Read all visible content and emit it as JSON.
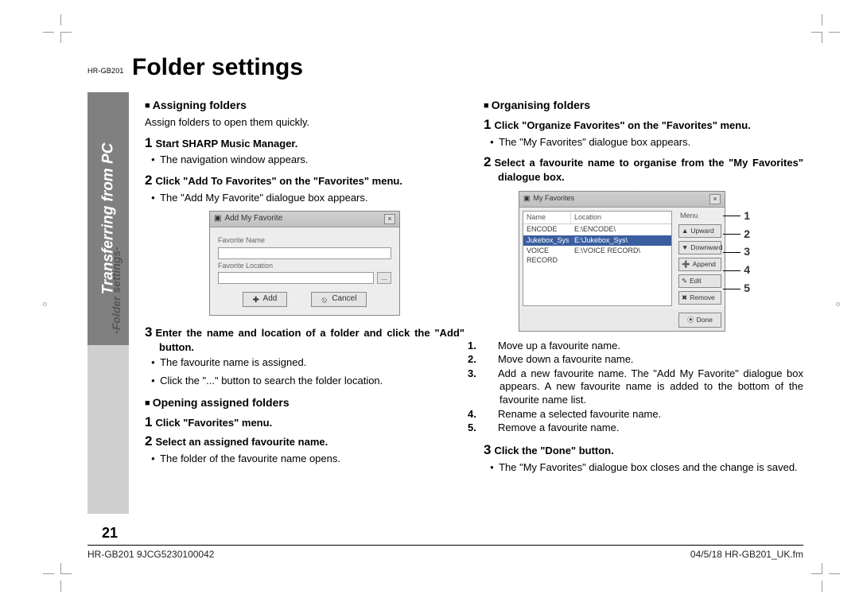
{
  "header": {
    "model": "HR-GB201",
    "title": "Folder settings"
  },
  "sidebar": {
    "main": "Transferring from PC",
    "sub": "-Folder settings-"
  },
  "pageNumber": "21",
  "left": {
    "sec1": {
      "heading": "Assigning folders",
      "intro": "Assign folders to open them quickly.",
      "step1": "Start SHARP Music Manager.",
      "step1_b": "The navigation window appears.",
      "step2": "Click \"Add To Favorites\" on the \"Favorites\" menu.",
      "step2_b": "The \"Add My Favorite\" dialogue box appears.",
      "step3": "Enter the name and location of a folder and click the \"Add\" button.",
      "step3_b1": "The favourite name is assigned.",
      "step3_b2": "Click the \"...\" button to search the folder location."
    },
    "sec2": {
      "heading": "Opening assigned folders",
      "step1": "Click \"Favorites\" menu.",
      "step2": "Select an assigned favourite name.",
      "step2_b": "The folder of the favourite name opens."
    },
    "dlg": {
      "title": "Add My Favorite",
      "lbl1": "Favorite Name",
      "lbl2": "Favorite Location",
      "browse": "...",
      "add": "Add",
      "cancel": "Cancel"
    }
  },
  "right": {
    "sec1": {
      "heading": "Organising folders",
      "step1": "Click \"Organize Favorites\" on the \"Favorites\" menu.",
      "step1_b": "The \"My Favorites\" dialogue box appears.",
      "step2": "Select a favourite name to organise from the \"My Favorites\" dialogue box.",
      "list": {
        "n1": "Move up a favourite name.",
        "n2": "Move down a favourite name.",
        "n3": "Add a new favourite name. The \"Add My Favorite\" dialogue box appears. A new favourite name is added to the bottom of the favourite name list.",
        "n4": "Rename a selected favourite name.",
        "n5": "Remove a favourite name."
      },
      "step3": "Click the \"Done\" button.",
      "step3_b": "The \"My Favorites\" dialogue box closes and the change is saved."
    },
    "dlg": {
      "title": "My Favorites",
      "col1": "Name",
      "col2": "Location",
      "menuhdr": "Menu",
      "rows": {
        "r1a": "ENCODE",
        "r1b": "E:\\ENCODE\\",
        "r2a": "Jukebox_Sys",
        "r2b": "E:\\Jukebox_Sys\\",
        "r3a": "VOICE RECORD",
        "r3b": "E:\\VOICE RECORD\\"
      },
      "btns": {
        "up": "Upward",
        "down": "Downward",
        "append": "Append",
        "edit": "Edit",
        "remove": "Remove",
        "done": "Done"
      }
    },
    "callouts": {
      "c1": "1",
      "c2": "2",
      "c3": "3",
      "c4": "4",
      "c5": "5"
    }
  },
  "footer": {
    "left": "HR-GB201 9JCG5230100042",
    "right": "04/5/18    HR-GB201_UK.fm"
  }
}
